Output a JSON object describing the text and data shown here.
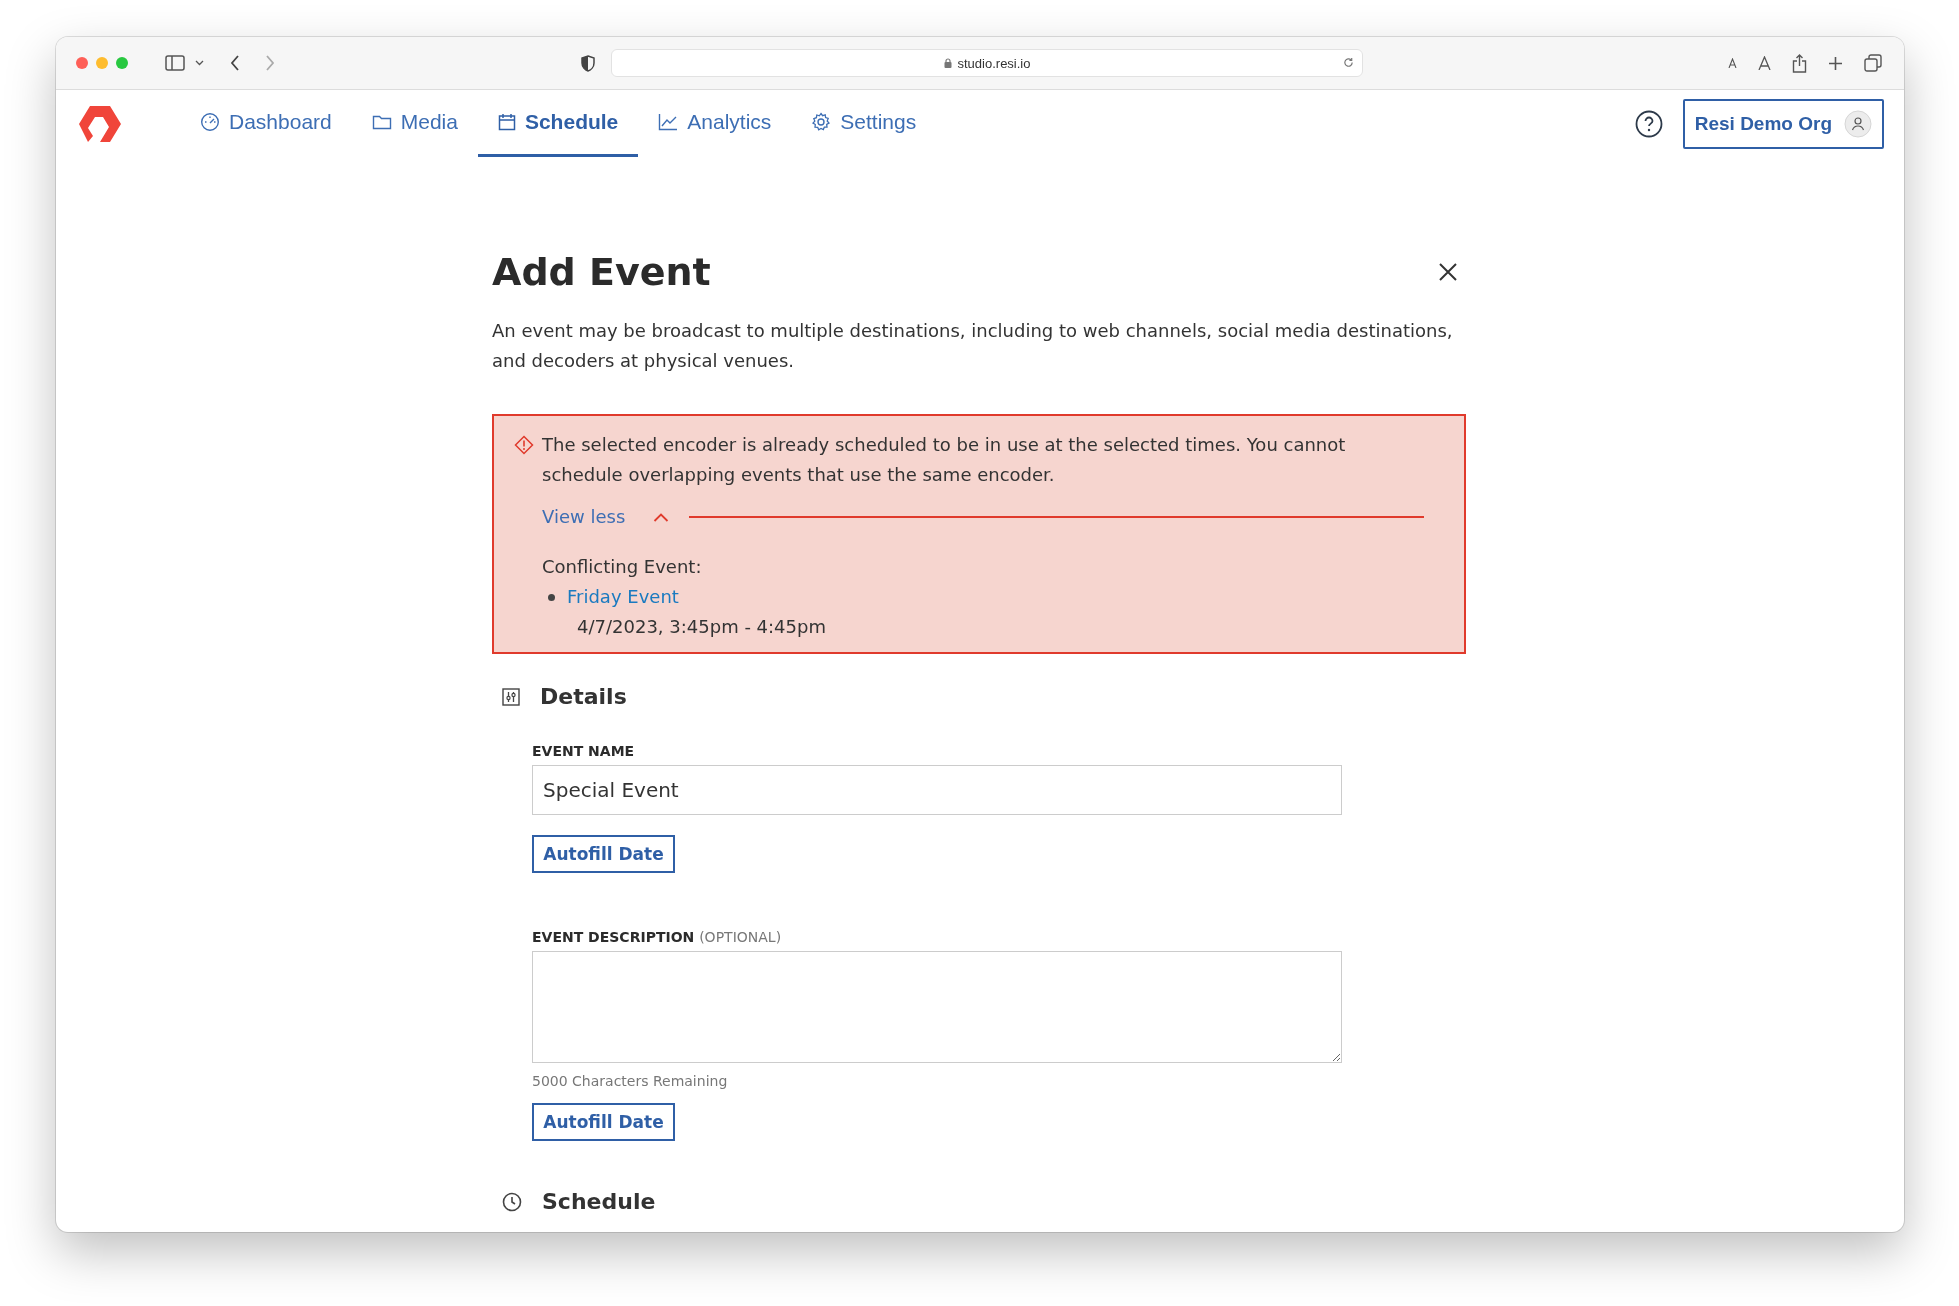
{
  "browser": {
    "url": "studio.resi.io"
  },
  "nav": {
    "tabs": [
      {
        "label": "Dashboard",
        "selected": false
      },
      {
        "label": "Media",
        "selected": false
      },
      {
        "label": "Schedule",
        "selected": true
      },
      {
        "label": "Analytics",
        "selected": false
      },
      {
        "label": "Settings",
        "selected": false
      }
    ],
    "org_button": "Resi Demo Org"
  },
  "dialog": {
    "title": "Add Event",
    "description": "An event may be broadcast to multiple destinations, including to web channels, social media destinations, and decoders at physical venues.",
    "alert": {
      "message": "The selected encoder is already scheduled to be in use at the selected times. You cannot schedule overlapping events that use the same encoder.",
      "toggle": "View less",
      "expanded": true,
      "conflict_label": "Conflicting Event:",
      "conflicts": [
        {
          "name": "Friday Event",
          "time": "4/7/2023, 3:45pm - 4:45pm"
        }
      ]
    },
    "details": {
      "title": "Details",
      "name_label": "EVENT NAME",
      "name_value": "Special Event",
      "autofill_1": "Autofill Date",
      "description_label": "EVENT DESCRIPTION",
      "description_optional": "(OPTIONAL)",
      "chars_remaining": "5000 Characters Remaining",
      "autofill_2": "Autofill Date"
    },
    "schedule": {
      "title": "Schedule"
    }
  }
}
